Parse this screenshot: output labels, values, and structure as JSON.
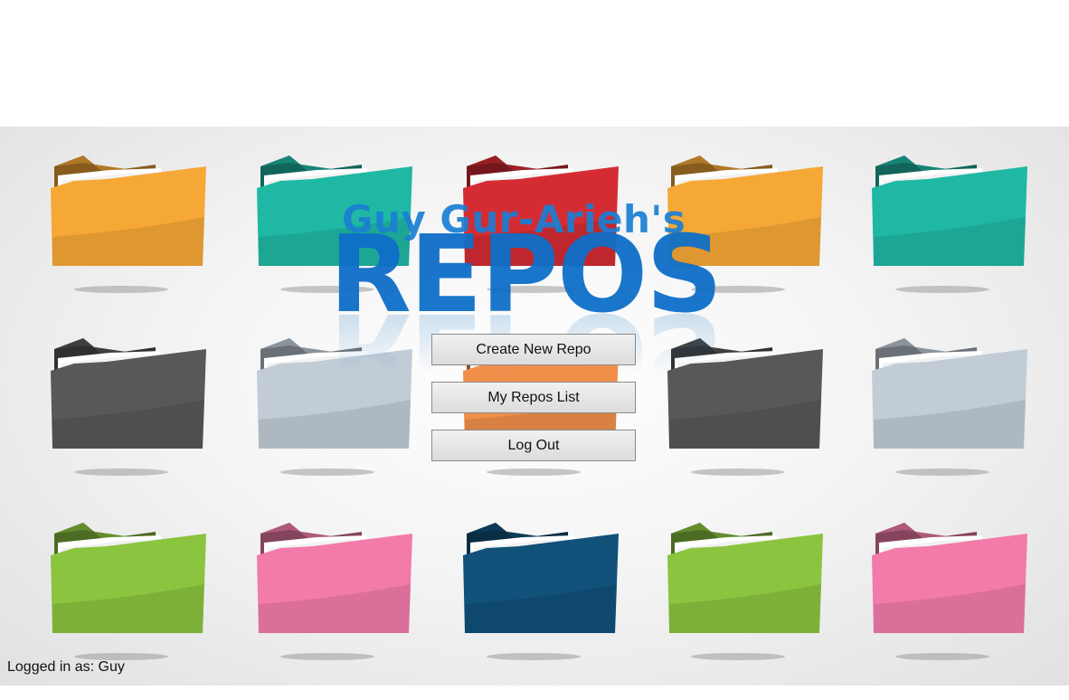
{
  "logo": {
    "small_text": "Guy Gur-Arieh's",
    "big_text": "REPOS"
  },
  "buttons": {
    "create_new_repo": "Create New Repo",
    "my_repos_list": "My Repos List",
    "log_out": "Log Out"
  },
  "status": {
    "logged_in_label": "Logged in as: Guy"
  },
  "folders": [
    {
      "color": "#F6A836"
    },
    {
      "color": "#1FB8A4"
    },
    {
      "color": "#D52C34"
    },
    {
      "color": "#F6A836"
    },
    {
      "color": "#1FB8A4"
    },
    {
      "color": "#585858"
    },
    {
      "color": "#C1CCD6"
    },
    {
      "color": "#F08F4A"
    },
    {
      "color": "#585858"
    },
    {
      "color": "#C1CCD6"
    },
    {
      "color": "#8BC43F"
    },
    {
      "color": "#F27BA9"
    },
    {
      "color": "#11517A"
    },
    {
      "color": "#8BC43F"
    },
    {
      "color": "#F27BA9"
    }
  ]
}
